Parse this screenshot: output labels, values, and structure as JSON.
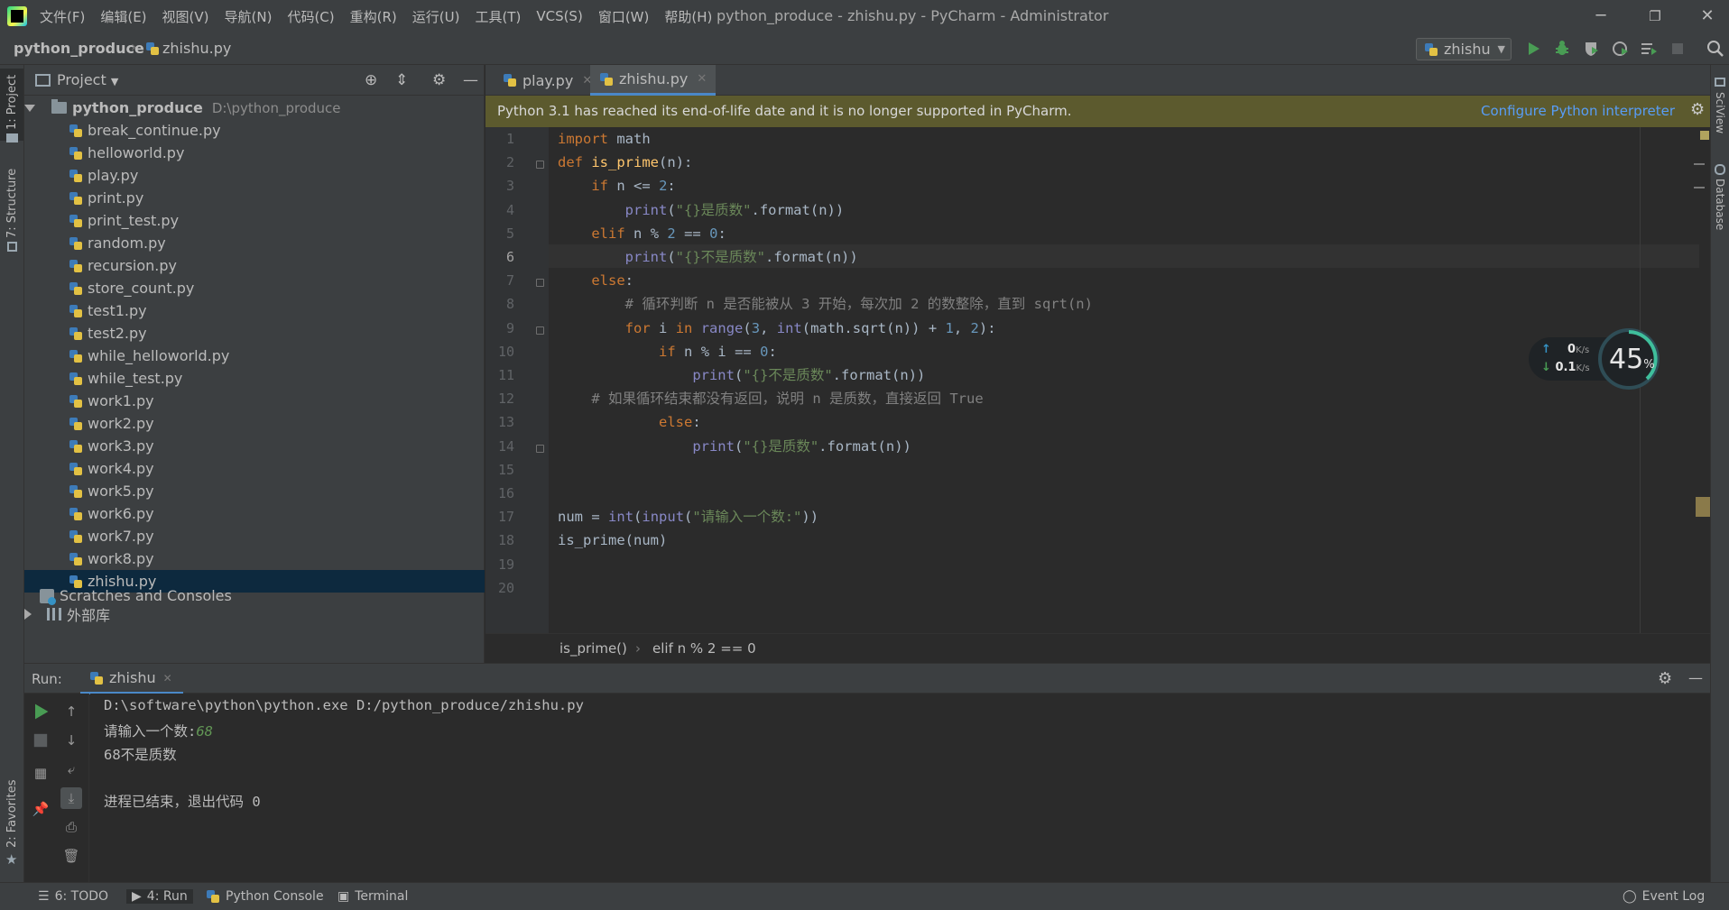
{
  "titlebar": {
    "menu": [
      "文件(F)",
      "编辑(E)",
      "视图(V)",
      "导航(N)",
      "代码(C)",
      "重构(R)",
      "运行(U)",
      "工具(T)",
      "VCS(S)",
      "窗口(W)",
      "帮助(H)"
    ],
    "title": "python_produce - zhishu.py - PyCharm - Administrator"
  },
  "navbar": {
    "project": "python_produce",
    "file": "zhishu.py",
    "run_config": "zhishu"
  },
  "left_strip": {
    "project": "1: Project",
    "structure": "7: Structure",
    "favorites": "2: Favorites"
  },
  "right_strip": {
    "sciview": "SciView",
    "database": "Database"
  },
  "project_panel": {
    "title": "Project",
    "root": {
      "name": "python_produce",
      "path": "D:\\python_produce"
    },
    "files": [
      "break_continue.py",
      "helloworld.py",
      "play.py",
      "print.py",
      "print_test.py",
      "random.py",
      "recursion.py",
      "store_count.py",
      "test1.py",
      "test2.py",
      "while_helloworld.py",
      "while_test.py",
      "work1.py",
      "work2.py",
      "work3.py",
      "work4.py",
      "work5.py",
      "work6.py",
      "work7.py",
      "work8.py",
      "zhishu.py"
    ],
    "selected": "zhishu.py",
    "scratches": "Scratches and Consoles",
    "external": "外部库"
  },
  "editor": {
    "tabs": [
      {
        "label": "play.py",
        "active": false
      },
      {
        "label": "zhishu.py",
        "active": true
      }
    ],
    "banner": {
      "text": "Python 3.1 has reached its end-of-life date and it is no longer supported in PyCharm.",
      "link": "Configure Python interpreter"
    },
    "current_line": 6,
    "line_numbers": [
      "1",
      "2",
      "3",
      "4",
      "5",
      "6",
      "7",
      "8",
      "9",
      "10",
      "11",
      "12",
      "13",
      "14",
      "15",
      "16",
      "17",
      "18",
      "19",
      "20"
    ],
    "lines": [
      "import math",
      "def is_prime(n):",
      "    if n <= 2:",
      "        print(\"{}是质数\".format(n))",
      "    elif n % 2 == 0:",
      "        print(\"{}不是质数\".format(n))",
      "    else:",
      "        # 循环判断 n 是否能被从 3 开始，每次加 2 的数整除，直到 sqrt(n)",
      "        for i in range(3, int(math.sqrt(n)) + 1, 2):",
      "            if n % i == 0:",
      "                print(\"{}不是质数\".format(n))",
      "    # 如果循环结束都没有返回，说明 n 是质数，直接返回 True",
      "            else:",
      "                print(\"{}是质数\".format(n))",
      "",
      "",
      "num = int(input(\"请输入一个数:\"))",
      "is_prime(num)",
      "",
      ""
    ],
    "breadcrumb": [
      "is_prime()",
      "elif n % 2 == 0"
    ]
  },
  "speed_widget": {
    "up": "0",
    "up_unit": "K/s",
    "down": "0.1",
    "down_unit": "K/s",
    "percent": "45",
    "percent_unit": "%"
  },
  "run_panel": {
    "label": "Run:",
    "tab": "zhishu",
    "console": {
      "command": "D:\\software\\python\\python.exe D:/python_produce/zhishu.py",
      "prompt": "请输入一个数:",
      "input": "68",
      "output": "68不是质数",
      "exit": "进程已结束，退出代码 0"
    }
  },
  "statusbar": {
    "todo": "6: TODO",
    "run": "4: Run",
    "python_console": "Python Console",
    "terminal": "Terminal",
    "event_log": "Event Log"
  },
  "colors": {
    "accent": "#4a88c7",
    "run_green": "#499c54",
    "keyword": "#cc7832",
    "string": "#6a8759"
  }
}
